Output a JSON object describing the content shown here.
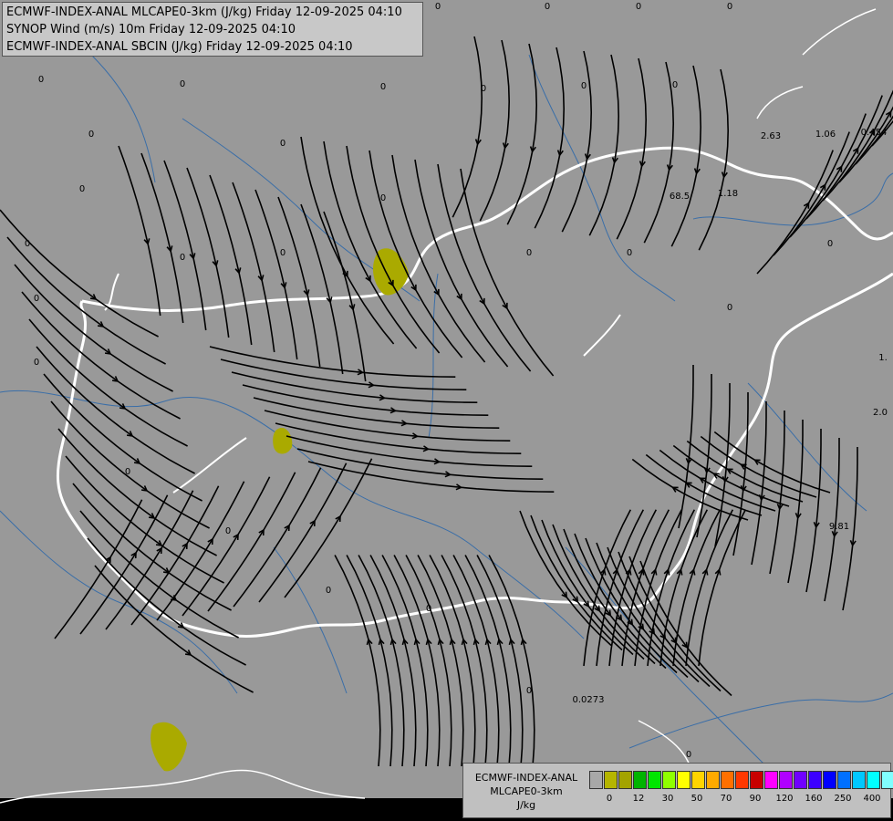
{
  "titles": [
    "ECMWF-INDEX-ANAL MLCAPE0-3km (J/kg) Friday 12-09-2025 04:10",
    "SYNOP Wind (m/s) 10m Friday 12-09-2025 04:10",
    "ECMWF-INDEX-ANAL SBCIN (J/kg) Friday 12-09-2025 04:10"
  ],
  "legend": {
    "title_lines": [
      "ECMWF-INDEX-ANAL",
      "MLCAPE0-3km",
      "J/kg"
    ],
    "colors": [
      "#a8a8a8",
      "#b5b500",
      "#a3a300",
      "#00b400",
      "#00e600",
      "#8fff00",
      "#ffff00",
      "#ffd400",
      "#ffaa00",
      "#ff7000",
      "#ff3800",
      "#c80000",
      "#ff00ff",
      "#b000ff",
      "#7000ff",
      "#3c00ff",
      "#0000ff",
      "#0070ff",
      "#00c8ff",
      "#00ffff",
      "#80ffff",
      "#ffffff"
    ],
    "ticks": [
      "0",
      "12",
      "30",
      "50",
      "70",
      "90",
      "120",
      "160",
      "250",
      "400"
    ]
  },
  "map": {
    "background": "#999999",
    "cape_fill": "#aaaa00",
    "border_color": "#ffffff",
    "river_color": "#3a6ea8",
    "streamline_color": "#000000",
    "values": [
      "0",
      "0",
      "0",
      "0",
      "0",
      "0",
      "0",
      "0",
      "0",
      "0",
      "0",
      "0",
      "0",
      "0",
      "0",
      "0",
      "0",
      "0",
      "0",
      "0",
      "0",
      "0",
      "0",
      "0",
      "0",
      "0",
      "0",
      "0",
      "0",
      "0",
      "0",
      "0",
      "2.63",
      "1.06",
      "0.454",
      "68.5",
      "1.18",
      "9.81",
      "0.0273",
      "2.0",
      "1.",
      "0"
    ]
  }
}
